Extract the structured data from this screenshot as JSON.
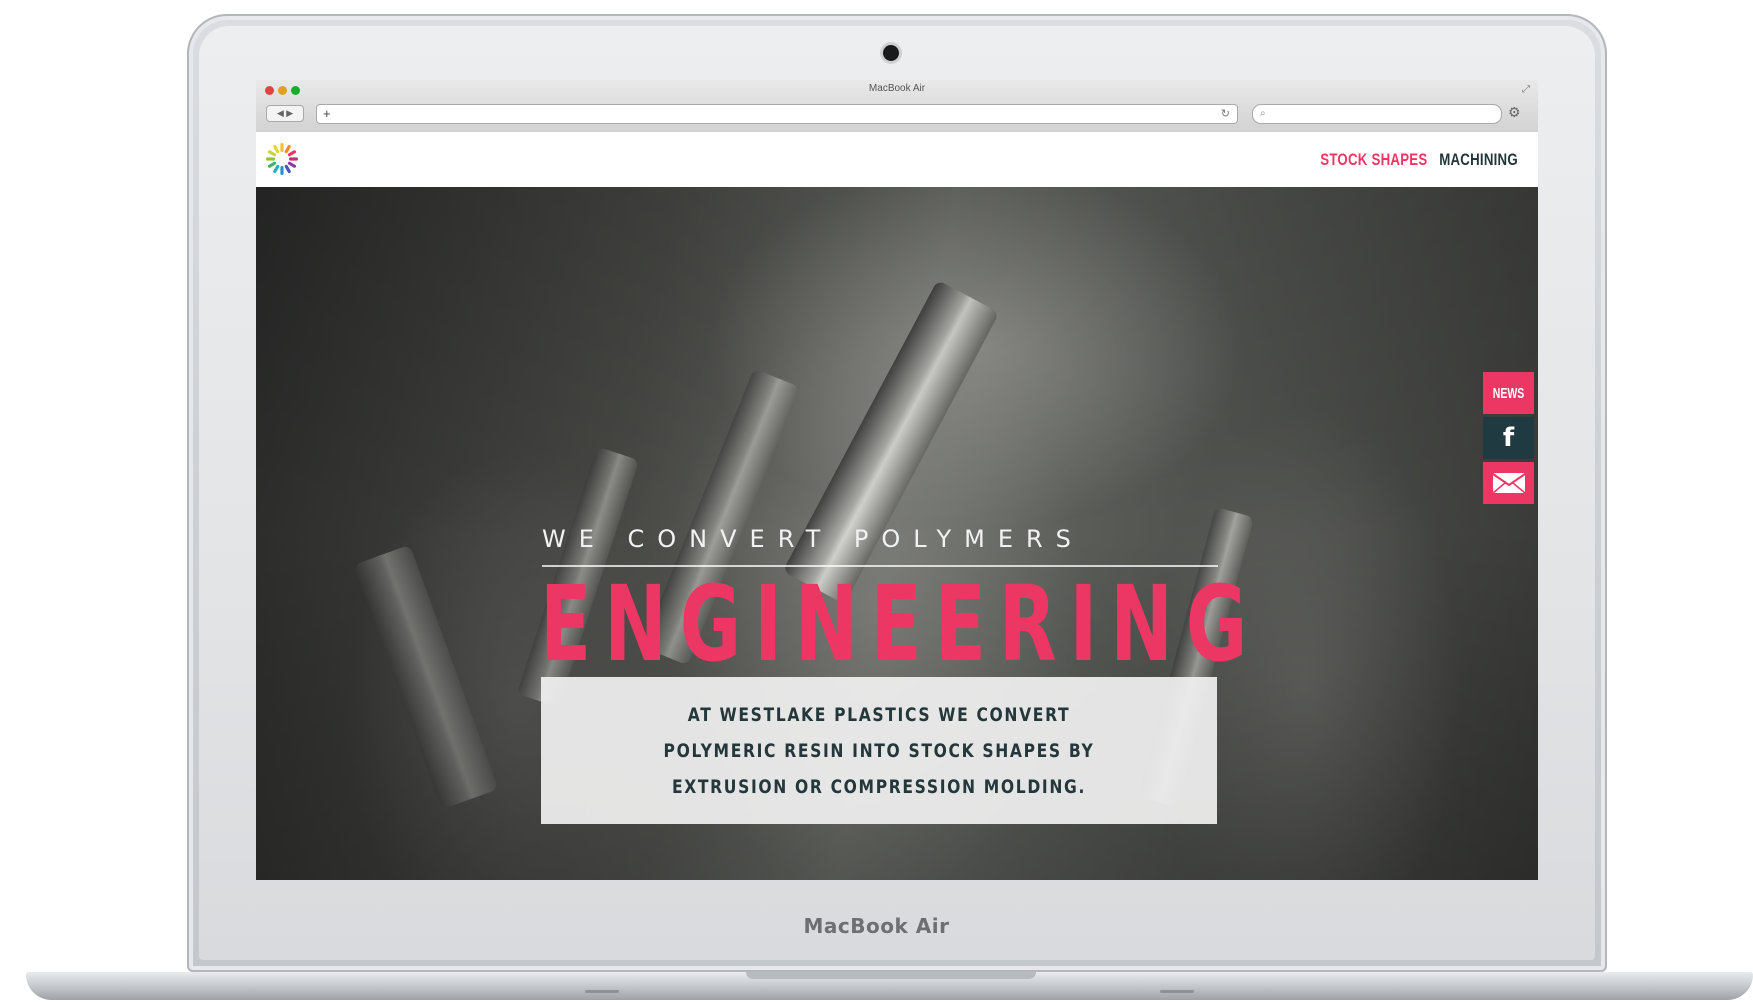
{
  "device": {
    "brand_label": "MacBook Air"
  },
  "browser": {
    "window_title": "MacBook Air",
    "nav_arrows": "◀ ▶",
    "address_plus": "+",
    "reload_icon": "reload-icon",
    "search_icon": "search-icon",
    "settings_icon": "gear-icon"
  },
  "site": {
    "nav": {
      "items": [
        {
          "label": "STOCK SHAPES",
          "color": "#ec3764"
        },
        {
          "label": "MACHINING",
          "color": "#22363a"
        }
      ]
    },
    "hero": {
      "tagline": "WE CONVERT POLYMERS",
      "title": "ENGINEERING",
      "intro": "AT WESTLAKE PLASTICS WE CONVERT POLYMERIC RESIN INTO STOCK SHAPES BY EXTRUSION OR COMPRESSION MOLDING."
    },
    "side_social": {
      "news_label": "NEWS",
      "facebook_glyph": "f",
      "icons": [
        "facebook-icon",
        "mail-icon"
      ]
    },
    "colors": {
      "accent": "#ec3764",
      "dark": "#22363a",
      "box": "#f0f0f0"
    }
  }
}
